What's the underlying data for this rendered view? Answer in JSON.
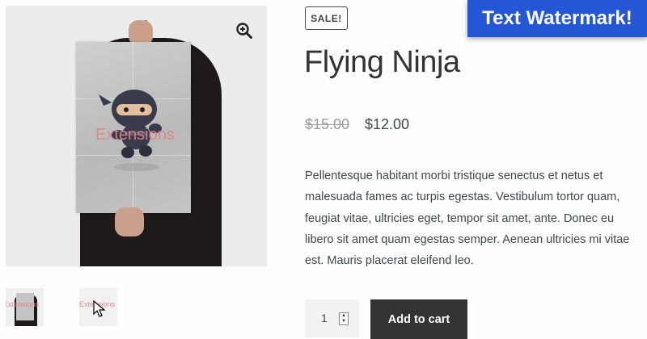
{
  "product": {
    "sale_badge": "Sale!",
    "title": "Flying Ninja",
    "price_regular": "$15.00",
    "price_sale": "$12.00",
    "description": "Pellentesque habitant morbi tristique senectus et netus et malesuada fames ac turpis egestas. Vestibulum tortor quam, feugiat vitae, ultricies eget, tempor sit amet, ante. Donec eu libero sit amet quam egestas semper. Aenean ultricies mi vitae est. Mauris placerat eleifend leo."
  },
  "gallery": {
    "image_watermark": "Extensions",
    "thumbnails": [
      {
        "watermark": "Extensions"
      },
      {
        "watermark": "Extensions"
      }
    ],
    "zoom_icon": "zoom-in-icon"
  },
  "cart": {
    "quantity": "1",
    "add_to_cart_label": "Add to cart"
  },
  "banner": {
    "text": "Text Watermark!"
  },
  "colors": {
    "banner_bg": "#2456d6",
    "button_bg": "#333333",
    "watermark": "#e08585"
  }
}
